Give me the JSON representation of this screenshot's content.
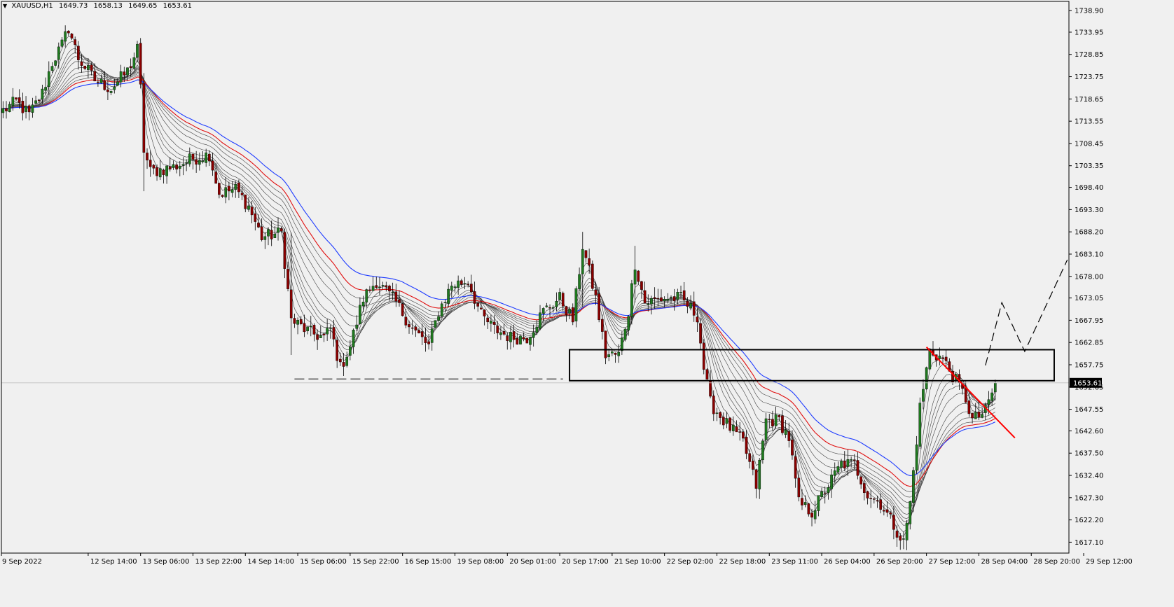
{
  "header": {
    "symbol_timeframe": "XAUUSD,H1",
    "open": "1649.73",
    "high": "1658.13",
    "low": "1649.65",
    "close": "1653.61"
  },
  "current_price_label": "1653.61",
  "colors": {
    "background": "#f0f0f0",
    "bull_candle": "#1f7a1f",
    "bear_candle": "#8b0000",
    "ema_blue": "#1f3cff",
    "ema_red": "#e01010",
    "ema_ribbon": "#404040",
    "trendline": "#ff0000",
    "dashed_projection": "#000000",
    "price_badge": "#000000"
  },
  "chart_data": {
    "type": "candlestick",
    "symbol": "XAUUSD",
    "timeframe": "H1",
    "ylim": [
      1614.6,
      1741.0
    ],
    "y_ticks": [
      "1738.90",
      "1733.95",
      "1728.85",
      "1723.75",
      "1718.65",
      "1713.55",
      "1708.45",
      "1703.35",
      "1698.40",
      "1693.30",
      "1688.20",
      "1683.10",
      "1678.00",
      "1673.05",
      "1667.95",
      "1662.85",
      "1657.75",
      "1652.65",
      "1647.55",
      "1642.60",
      "1637.50",
      "1632.40",
      "1627.30",
      "1622.20",
      "1617.10"
    ],
    "x_ticks": [
      "9 Sep 2022",
      "12 Sep 14:00",
      "13 Sep 06:00",
      "13 Sep 22:00",
      "14 Sep 14:00",
      "15 Sep 06:00",
      "15 Sep 22:00",
      "16 Sep 15:00",
      "19 Sep 08:00",
      "20 Sep 01:00",
      "20 Sep 17:00",
      "21 Sep 10:00",
      "22 Sep 02:00",
      "22 Sep 18:00",
      "23 Sep 11:00",
      "26 Sep 04:00",
      "26 Sep 20:00",
      "27 Sep 12:00",
      "28 Sep 04:00",
      "28 Sep 20:00",
      "29 Sep 12:00"
    ],
    "price_anchors": [
      [
        0,
        1716
      ],
      [
        4,
        1718
      ],
      [
        8,
        1715
      ],
      [
        12,
        1720
      ],
      [
        15,
        1727
      ],
      [
        18,
        1731
      ],
      [
        20,
        1735
      ],
      [
        23,
        1728
      ],
      [
        28,
        1723
      ],
      [
        33,
        1721
      ],
      [
        38,
        1725
      ],
      [
        41,
        1730
      ],
      [
        42,
        1721
      ],
      [
        43,
        1707
      ],
      [
        45,
        1702
      ],
      [
        52,
        1703
      ],
      [
        58,
        1705
      ],
      [
        63,
        1706
      ],
      [
        66,
        1697
      ],
      [
        71,
        1698
      ],
      [
        75,
        1694
      ],
      [
        79,
        1687
      ],
      [
        85,
        1688
      ],
      [
        88,
        1668
      ],
      [
        94,
        1665
      ],
      [
        98,
        1664
      ],
      [
        100,
        1666
      ],
      [
        103,
        1657
      ],
      [
        106,
        1662
      ],
      [
        110,
        1673
      ],
      [
        114,
        1677
      ],
      [
        120,
        1672
      ],
      [
        125,
        1666
      ],
      [
        130,
        1662
      ],
      [
        133,
        1670
      ],
      [
        137,
        1676
      ],
      [
        142,
        1677
      ],
      [
        146,
        1669
      ],
      [
        150,
        1666
      ],
      [
        155,
        1664
      ],
      [
        160,
        1664
      ],
      [
        165,
        1670
      ],
      [
        170,
        1673
      ],
      [
        174,
        1668
      ],
      [
        177,
        1685
      ],
      [
        181,
        1673
      ],
      [
        184,
        1660
      ],
      [
        188,
        1660
      ],
      [
        191,
        1670
      ],
      [
        193,
        1681
      ],
      [
        196,
        1672
      ],
      [
        202,
        1673
      ],
      [
        207,
        1673
      ],
      [
        212,
        1669
      ],
      [
        214,
        1657
      ],
      [
        216,
        1649
      ],
      [
        220,
        1645
      ],
      [
        226,
        1640
      ],
      [
        230,
        1630
      ],
      [
        233,
        1645
      ],
      [
        237,
        1645
      ],
      [
        240,
        1641
      ],
      [
        243,
        1626
      ],
      [
        247,
        1624
      ],
      [
        251,
        1629
      ],
      [
        256,
        1635
      ],
      [
        260,
        1635
      ],
      [
        264,
        1628
      ],
      [
        268,
        1626
      ],
      [
        272,
        1621
      ],
      [
        275,
        1617
      ],
      [
        277,
        1626
      ],
      [
        280,
        1648
      ],
      [
        283,
        1661
      ],
      [
        287,
        1659
      ],
      [
        291,
        1654
      ],
      [
        294,
        1650
      ],
      [
        296,
        1645
      ],
      [
        300,
        1647
      ],
      [
        303,
        1653.61
      ]
    ],
    "moving_averages": {
      "count": 12,
      "highlighted": [
        {
          "line": "ema_red"
        },
        {
          "line": "ema_blue"
        }
      ]
    },
    "annotations": {
      "support_line_dashed": {
        "from_bar": 89,
        "to_bar": 171,
        "price": 1654.5
      },
      "resistance_zone": {
        "from_bar": 173,
        "to_bar": 321,
        "top": 1661.2,
        "bottom": 1654.1
      },
      "down_trendline": {
        "from_bar": 282,
        "from_price": 1661.8,
        "to_bar": 309,
        "to_price": 1641.0
      },
      "projection_path": [
        [
          300,
          1657.6
        ],
        [
          305,
          1672.0
        ],
        [
          312,
          1660.8
        ],
        [
          325,
          1681.8
        ]
      ],
      "current_price_line": 1653.61
    }
  }
}
